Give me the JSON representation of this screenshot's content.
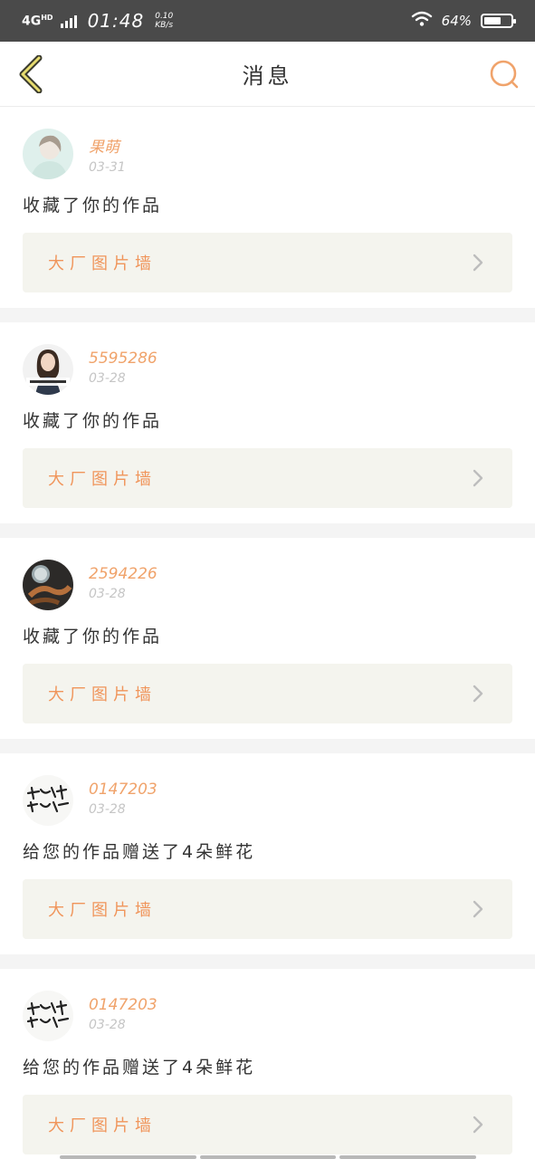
{
  "status_bar": {
    "network": "4G",
    "network_sup": "HD",
    "time": "01:48",
    "speed_value": "0.10",
    "speed_unit": "KB/s",
    "battery_percent": "64%",
    "battery_level": 0.64
  },
  "header": {
    "title": "消息",
    "back_icon": "chevron-left-icon",
    "search_icon": "search-icon",
    "accent_color": "#f0a36b"
  },
  "messages": [
    {
      "username": "果萌",
      "date": "03-31",
      "action": "收藏了你的作品",
      "work_title": "大厂图片墙",
      "avatar_icon": "avatar-girl"
    },
    {
      "username": "5595286",
      "date": "03-28",
      "action": "收藏了你的作品",
      "work_title": "大厂图片墙",
      "avatar_icon": "avatar-woman"
    },
    {
      "username": "2594226",
      "date": "03-28",
      "action": "收藏了你的作品",
      "work_title": "大厂图片墙",
      "avatar_icon": "avatar-chains"
    },
    {
      "username": "0147203",
      "date": "03-28",
      "action": "给您的作品赠送了4朵鲜花",
      "work_title": "大厂图片墙",
      "avatar_icon": "avatar-calligraphy"
    },
    {
      "username": "0147203",
      "date": "03-28",
      "action": "给您的作品赠送了4朵鲜花",
      "work_title": "大厂图片墙",
      "avatar_icon": "avatar-calligraphy"
    }
  ]
}
